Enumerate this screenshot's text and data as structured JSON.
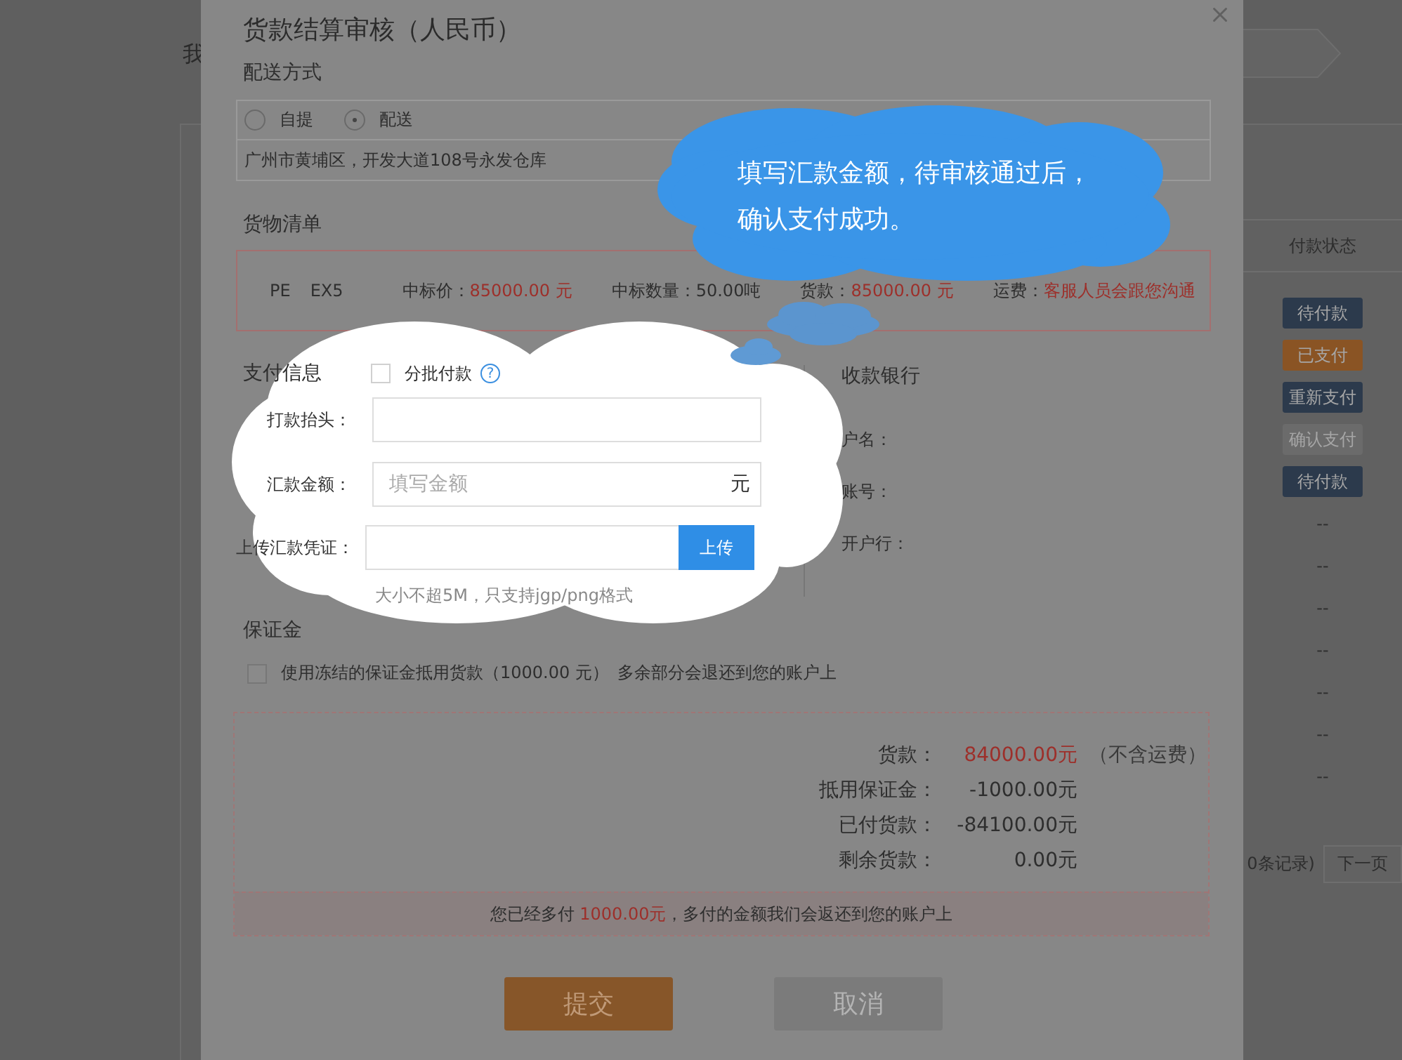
{
  "background": {
    "heading_fragment": "我",
    "status_column": {
      "header": "付款状态",
      "rows": [
        {
          "kind": "badge",
          "text": "待付款",
          "color": "#2c3a4c"
        },
        {
          "kind": "badge",
          "text": "已支付",
          "color": "#8a5424"
        },
        {
          "kind": "badge",
          "text": "重新支付",
          "color": "#2c3a4c"
        },
        {
          "kind": "badge",
          "text": "确认支付",
          "color": "#6b6b6b"
        },
        {
          "kind": "badge",
          "text": "待付款",
          "color": "#2c3a4c"
        },
        {
          "kind": "text",
          "text": "--"
        },
        {
          "kind": "text",
          "text": "--"
        },
        {
          "kind": "text",
          "text": "--"
        },
        {
          "kind": "text",
          "text": "--"
        },
        {
          "kind": "text",
          "text": "--"
        },
        {
          "kind": "text",
          "text": "--"
        },
        {
          "kind": "text",
          "text": "--"
        }
      ]
    },
    "pager": {
      "records": "0条记录)",
      "next": "下一页"
    }
  },
  "dialog": {
    "title": "货款结算审核（人民币）",
    "delivery": {
      "label": "配送方式",
      "options": [
        {
          "label": "自提",
          "selected": false
        },
        {
          "label": "配送",
          "selected": true
        }
      ],
      "address": "广州市黄埔区，开发大道108号永发仓库"
    },
    "goods": {
      "label": "货物清单",
      "product": [
        "PE",
        "EX5"
      ],
      "fields": [
        {
          "label": "中标价：",
          "value": "85000.00 元",
          "highlight": true
        },
        {
          "label": "中标数量：",
          "value": "50.00吨",
          "highlight": false
        },
        {
          "label": "货款：",
          "value": "85000.00 元",
          "highlight": true
        },
        {
          "label": "运费：",
          "value": "客服人员会跟您沟通",
          "highlight": true
        }
      ]
    },
    "payment": {
      "label": "支付信息",
      "batch": {
        "label": "分批付款",
        "checked": false,
        "help": "?"
      },
      "fields": [
        {
          "kind": "text",
          "label": "打款抬头："
        },
        {
          "kind": "amount",
          "label": "汇款金额：",
          "placeholder": "填写金额",
          "unit": "元"
        },
        {
          "kind": "upload",
          "label": "上传汇款凭证：",
          "button": "上传",
          "hint": "大小不超5M，只支持jgp/png格式"
        }
      ]
    },
    "bank": {
      "label": "收款银行",
      "fields": [
        "户名：",
        "账号：",
        "开户行："
      ]
    },
    "deposit": {
      "label": "保证金",
      "checked": false,
      "text": "使用冻结的保证金抵用货款（1000.00 元）",
      "note": "多余部分会退还到您的账户上"
    },
    "summary": {
      "rows": [
        {
          "label": "货款：",
          "value": "84000.00元",
          "highlight": true,
          "note": "（不含运费）"
        },
        {
          "label": "抵用保证金：",
          "value": "-1000.00元",
          "highlight": false
        },
        {
          "label": "已付货款：",
          "value": "-84100.00元",
          "highlight": false
        },
        {
          "label": "剩余货款：",
          "value": "0.00元",
          "highlight": false
        }
      ],
      "notice": {
        "before": "您已经多付 ",
        "amount": "1000.00元",
        "after": "，多付的金额我们会返还到您的账户上"
      }
    },
    "buttons": [
      {
        "label": "提交",
        "kind": "primary"
      },
      {
        "label": "取消",
        "kind": "secondary"
      }
    ],
    "tip": {
      "lines": [
        "填写汇款金额，待审核通过后，",
        "确认支付成功。"
      ]
    }
  }
}
